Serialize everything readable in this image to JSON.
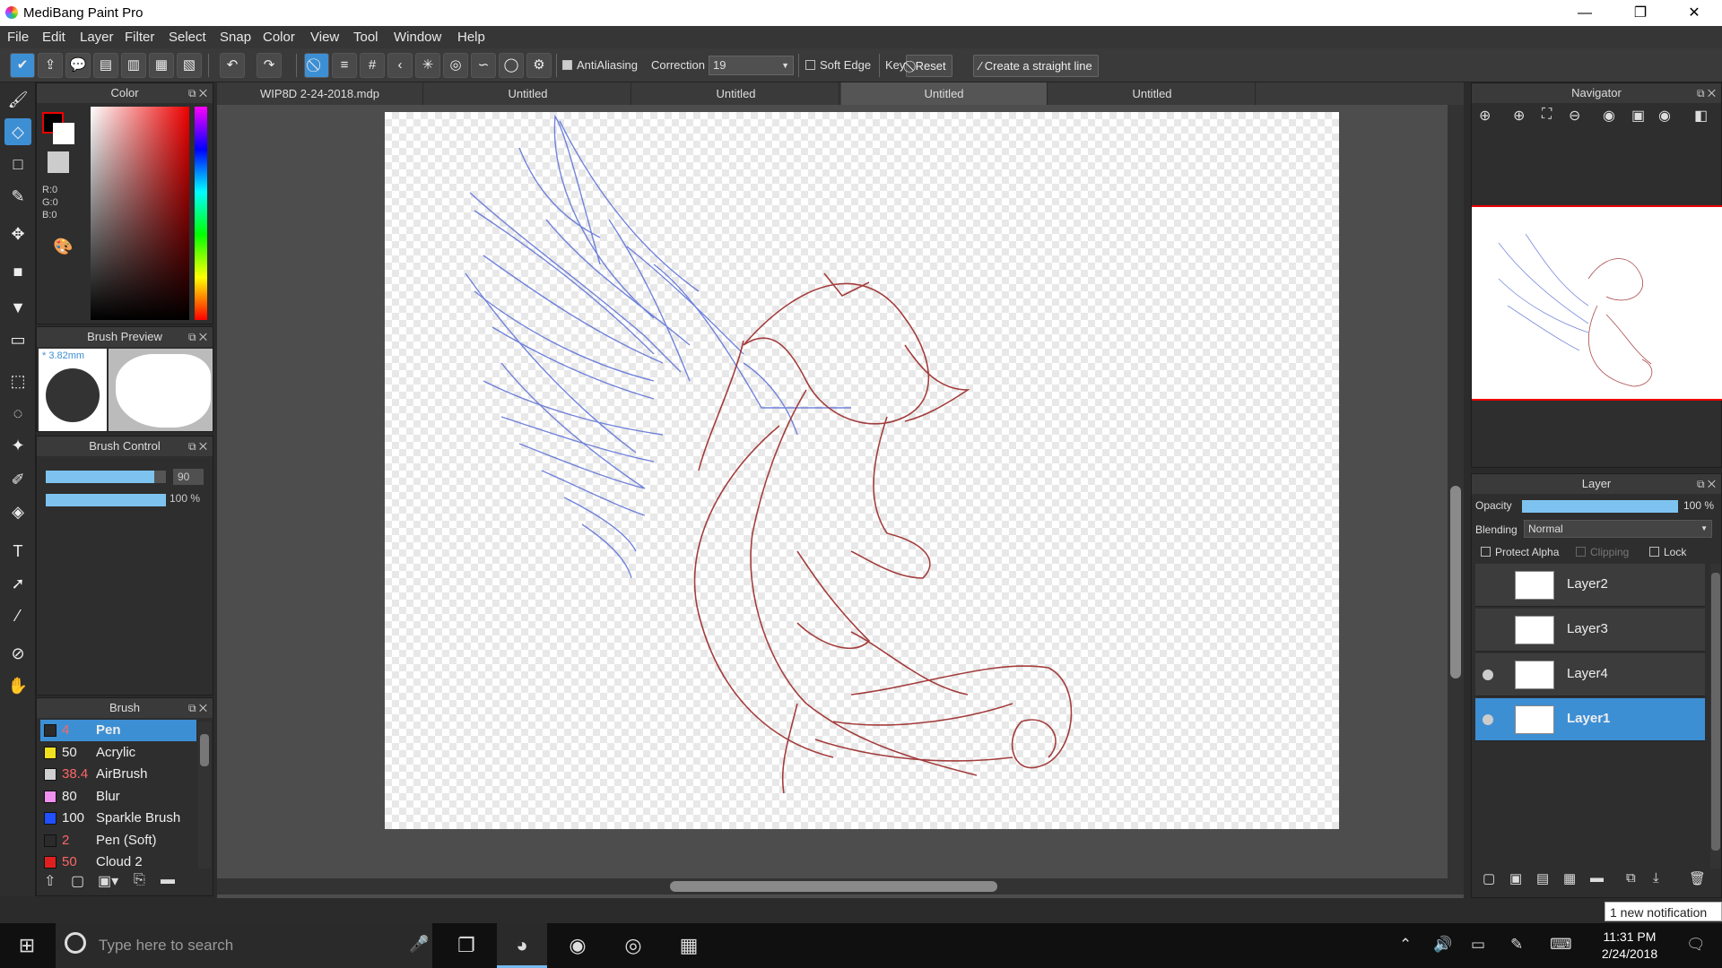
{
  "window": {
    "title": "MediBang Paint Pro",
    "min": "—",
    "max": "❐",
    "close": "✕"
  },
  "menu": [
    "File",
    "Edit",
    "Layer",
    "Filter",
    "Select",
    "Snap",
    "Color",
    "View",
    "Tool",
    "Window",
    "Help"
  ],
  "toolbar": {
    "antialiasing": "AntiAliasing",
    "correction_label": "Correction",
    "correction_value": "19",
    "soft_edge": "Soft Edge",
    "key": "Key",
    "reset": "Reset",
    "straight_line": "Create a straight line"
  },
  "color_panel": {
    "title": "Color",
    "r": "R:0",
    "g": "G:0",
    "b": "B:0"
  },
  "brush_preview": {
    "title": "Brush Preview",
    "size": "* 3.82mm"
  },
  "brush_control": {
    "title": "Brush Control",
    "size_value": "90",
    "opacity_value": "100 %",
    "size_fraction": 0.9,
    "opacity_fraction": 1.0
  },
  "brush_panel": {
    "title": "Brush",
    "items": [
      {
        "size": "4",
        "name": "Pen",
        "color": "#2b2b2b",
        "size_color": "#ff6666"
      },
      {
        "size": "50",
        "name": "Acrylic",
        "color": "#f0e020",
        "size_color": "#eeeeee"
      },
      {
        "size": "38.4",
        "name": "AirBrush",
        "color": "#d0d0d0",
        "size_color": "#ff6666"
      },
      {
        "size": "80",
        "name": "Blur",
        "color": "#f090f0",
        "size_color": "#eeeeee"
      },
      {
        "size": "100",
        "name": "Sparkle Brush",
        "color": "#2050ff",
        "size_color": "#eeeeee"
      },
      {
        "size": "2",
        "name": "Pen (Soft)",
        "color": "#2b2b2b",
        "size_color": "#ff6666"
      },
      {
        "size": "50",
        "name": "Cloud 2",
        "color": "#e02020",
        "size_color": "#ff6666"
      }
    ]
  },
  "doc_tabs": [
    "WIP8D 2-24-2018.mdp",
    "Untitled",
    "Untitled",
    "Untitled",
    "Untitled"
  ],
  "navigator": {
    "title": "Navigator"
  },
  "layer_panel": {
    "title": "Layer",
    "opacity_label": "Opacity",
    "opacity_value": "100 %",
    "opacity_fraction": 1.0,
    "blending_label": "Blending",
    "blending_value": "Normal",
    "protect_alpha": "Protect Alpha",
    "clipping": "Clipping",
    "lock": "Lock",
    "layers": [
      {
        "name": "Layer2",
        "visible": false,
        "selected": false
      },
      {
        "name": "Layer3",
        "visible": false,
        "selected": false
      },
      {
        "name": "Layer4",
        "visible": true,
        "selected": false
      },
      {
        "name": "Layer1",
        "visible": true,
        "selected": true
      }
    ]
  },
  "notification": "1 new notification",
  "taskbar": {
    "search_placeholder": "Type here to search",
    "time": "11:31 PM",
    "date": "2/24/2018"
  },
  "colors": {
    "accent": "#3d8fd4",
    "sketch_blue": "#5a6fd6",
    "sketch_red": "#9b2a2a"
  }
}
